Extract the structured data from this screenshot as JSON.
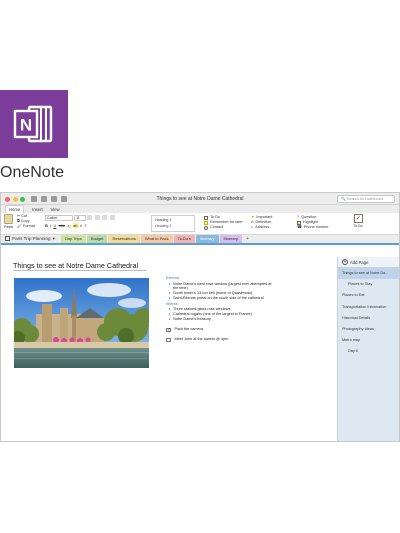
{
  "app": {
    "name": "OneNote",
    "logo_letter": "N",
    "brand_color": "#7B3D99"
  },
  "window": {
    "title": "Things to see at Notre Dame Cathedral",
    "search_placeholder": "Search All Notebooks",
    "traffic_lights": [
      "#fc605c",
      "#fdbc40",
      "#34c84a"
    ]
  },
  "ribbon_tabs": [
    "Home",
    "Insert",
    "View"
  ],
  "ribbon": {
    "cut": "Cut",
    "copy": "Copy",
    "paste": "Paste",
    "format": "Format",
    "font_name": "Calibri",
    "font_size": "11",
    "heading1": "Heading 1",
    "heading2": "Heading 2",
    "tags": [
      [
        "To Do",
        "Important",
        "Question"
      ],
      [
        "Remember for later",
        "Definition",
        "Highlight"
      ],
      [
        "Contact",
        "Address",
        "Phone number"
      ]
    ],
    "todo_label": "To Do"
  },
  "notebook": {
    "name": "Paris Trip Planning",
    "sections": [
      {
        "label": "Day Trips",
        "color": "#cfe3a3"
      },
      {
        "label": "Budget",
        "color": "#b9dbaa"
      },
      {
        "label": "Reservations",
        "color": "#f3d99a"
      },
      {
        "label": "What to Pack",
        "color": "#f7c9a2"
      },
      {
        "label": "To-Do's",
        "color": "#f4b3b3"
      },
      {
        "label": "Itinerary",
        "color": "#8ab8e0",
        "active": true
      },
      {
        "label": "Itinerary",
        "color": "#d7bde9"
      }
    ],
    "add_section": "+"
  },
  "page": {
    "title": "Things to see at Notre Dame Cathedral",
    "exterior_heading": "Exterior:",
    "exterior_items": [
      "Notre Dame's west rose window (largest ever attempted at",
      "the time)",
      "South tower's 13-ton bell (home of Quasimodo)",
      "Saint-Étienne portal on the south side of the cathedral"
    ],
    "interior_heading": "Interior:",
    "interior_items": [
      "Three stained-glass rose windows",
      "Cathedral organs (one of the largest in France)",
      "Notre Dame's treasury"
    ],
    "todos": [
      {
        "label": "Pack the camera",
        "checked": true
      },
      {
        "label": "Meet John at the towers @ 4pm",
        "checked": false
      }
    ]
  },
  "pages_pane": {
    "add_page": "Add Page",
    "pages": [
      {
        "label": "Things to see at Notre Da...",
        "level": 0,
        "selected": true
      },
      {
        "label": "Places to Stay",
        "level": 1
      },
      {
        "label": "Places to Eat",
        "level": 0
      },
      {
        "label": "Transportation Information",
        "level": 0
      },
      {
        "label": "Historical Details",
        "level": 0
      },
      {
        "label": "Photography Ideas",
        "level": 0
      },
      {
        "label": "Metro map",
        "level": 0
      },
      {
        "label": "Day 6",
        "level": 1
      }
    ]
  }
}
